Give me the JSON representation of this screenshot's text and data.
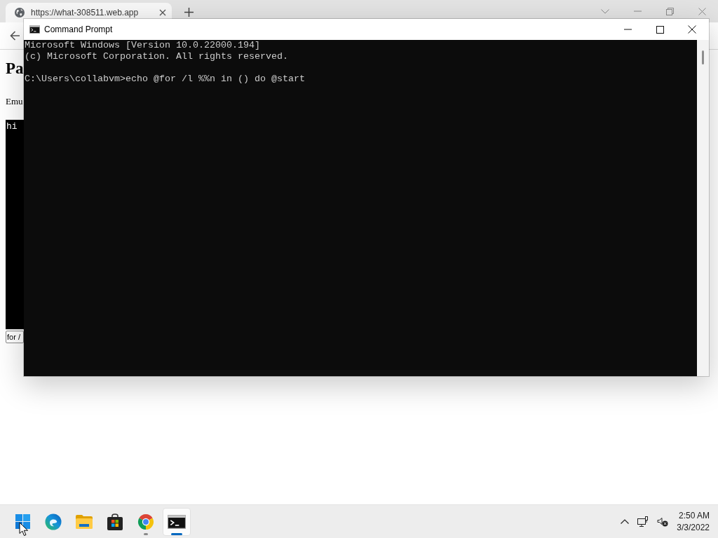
{
  "browser": {
    "tab": {
      "title": "https://what-308511.web.app",
      "selected": true
    },
    "page": {
      "heading": "Pa",
      "paragraph": "Emu",
      "text_area": {
        "value": "hi"
      },
      "text_input": {
        "value": "for /"
      }
    }
  },
  "command_prompt": {
    "title": "Command Prompt",
    "output": [
      "Microsoft Windows [Version 10.0.22000.194]",
      "(c) Microsoft Corporation. All rights reserved."
    ],
    "prompt_line": "C:\\Users\\collabvm>echo @for /l %%n in () do @start"
  },
  "taskbar": {
    "apps": [
      {
        "kind": "start",
        "running": false,
        "selected": false
      },
      {
        "kind": "edge",
        "running": false,
        "selected": false
      },
      {
        "kind": "files",
        "running": false,
        "selected": false
      },
      {
        "kind": "store",
        "running": false,
        "selected": false
      },
      {
        "kind": "chrome",
        "running": true,
        "selected": false
      },
      {
        "kind": "terminal",
        "running": true,
        "selected": true
      }
    ],
    "tray": {
      "volume_muted": true
    },
    "clock": {
      "time": "2:50 AM",
      "date": "3/3/2022"
    }
  }
}
